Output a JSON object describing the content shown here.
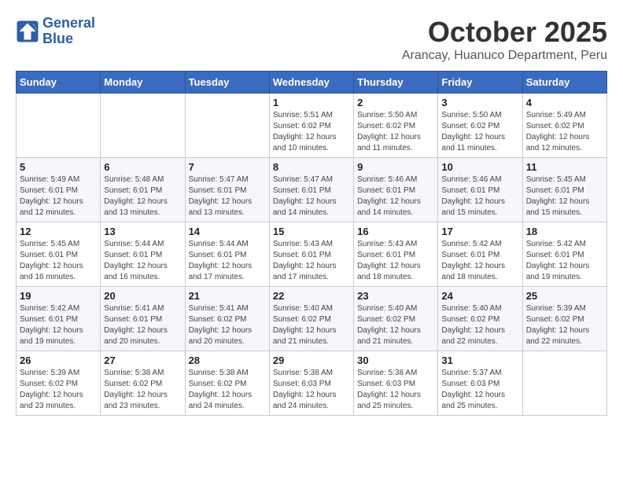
{
  "header": {
    "logo_line1": "General",
    "logo_line2": "Blue",
    "month_title": "October 2025",
    "location": "Arancay, Huanuco Department, Peru"
  },
  "weekdays": [
    "Sunday",
    "Monday",
    "Tuesday",
    "Wednesday",
    "Thursday",
    "Friday",
    "Saturday"
  ],
  "weeks": [
    [
      {
        "day": "",
        "info": ""
      },
      {
        "day": "",
        "info": ""
      },
      {
        "day": "",
        "info": ""
      },
      {
        "day": "1",
        "info": "Sunrise: 5:51 AM\nSunset: 6:02 PM\nDaylight: 12 hours\nand 10 minutes."
      },
      {
        "day": "2",
        "info": "Sunrise: 5:50 AM\nSunset: 6:02 PM\nDaylight: 12 hours\nand 11 minutes."
      },
      {
        "day": "3",
        "info": "Sunrise: 5:50 AM\nSunset: 6:02 PM\nDaylight: 12 hours\nand 11 minutes."
      },
      {
        "day": "4",
        "info": "Sunrise: 5:49 AM\nSunset: 6:02 PM\nDaylight: 12 hours\nand 12 minutes."
      }
    ],
    [
      {
        "day": "5",
        "info": "Sunrise: 5:49 AM\nSunset: 6:01 PM\nDaylight: 12 hours\nand 12 minutes."
      },
      {
        "day": "6",
        "info": "Sunrise: 5:48 AM\nSunset: 6:01 PM\nDaylight: 12 hours\nand 13 minutes."
      },
      {
        "day": "7",
        "info": "Sunrise: 5:47 AM\nSunset: 6:01 PM\nDaylight: 12 hours\nand 13 minutes."
      },
      {
        "day": "8",
        "info": "Sunrise: 5:47 AM\nSunset: 6:01 PM\nDaylight: 12 hours\nand 14 minutes."
      },
      {
        "day": "9",
        "info": "Sunrise: 5:46 AM\nSunset: 6:01 PM\nDaylight: 12 hours\nand 14 minutes."
      },
      {
        "day": "10",
        "info": "Sunrise: 5:46 AM\nSunset: 6:01 PM\nDaylight: 12 hours\nand 15 minutes."
      },
      {
        "day": "11",
        "info": "Sunrise: 5:45 AM\nSunset: 6:01 PM\nDaylight: 12 hours\nand 15 minutes."
      }
    ],
    [
      {
        "day": "12",
        "info": "Sunrise: 5:45 AM\nSunset: 6:01 PM\nDaylight: 12 hours\nand 16 minutes."
      },
      {
        "day": "13",
        "info": "Sunrise: 5:44 AM\nSunset: 6:01 PM\nDaylight: 12 hours\nand 16 minutes."
      },
      {
        "day": "14",
        "info": "Sunrise: 5:44 AM\nSunset: 6:01 PM\nDaylight: 12 hours\nand 17 minutes."
      },
      {
        "day": "15",
        "info": "Sunrise: 5:43 AM\nSunset: 6:01 PM\nDaylight: 12 hours\nand 17 minutes."
      },
      {
        "day": "16",
        "info": "Sunrise: 5:43 AM\nSunset: 6:01 PM\nDaylight: 12 hours\nand 18 minutes."
      },
      {
        "day": "17",
        "info": "Sunrise: 5:42 AM\nSunset: 6:01 PM\nDaylight: 12 hours\nand 18 minutes."
      },
      {
        "day": "18",
        "info": "Sunrise: 5:42 AM\nSunset: 6:01 PM\nDaylight: 12 hours\nand 19 minutes."
      }
    ],
    [
      {
        "day": "19",
        "info": "Sunrise: 5:42 AM\nSunset: 6:01 PM\nDaylight: 12 hours\nand 19 minutes."
      },
      {
        "day": "20",
        "info": "Sunrise: 5:41 AM\nSunset: 6:01 PM\nDaylight: 12 hours\nand 20 minutes."
      },
      {
        "day": "21",
        "info": "Sunrise: 5:41 AM\nSunset: 6:02 PM\nDaylight: 12 hours\nand 20 minutes."
      },
      {
        "day": "22",
        "info": "Sunrise: 5:40 AM\nSunset: 6:02 PM\nDaylight: 12 hours\nand 21 minutes."
      },
      {
        "day": "23",
        "info": "Sunrise: 5:40 AM\nSunset: 6:02 PM\nDaylight: 12 hours\nand 21 minutes."
      },
      {
        "day": "24",
        "info": "Sunrise: 5:40 AM\nSunset: 6:02 PM\nDaylight: 12 hours\nand 22 minutes."
      },
      {
        "day": "25",
        "info": "Sunrise: 5:39 AM\nSunset: 6:02 PM\nDaylight: 12 hours\nand 22 minutes."
      }
    ],
    [
      {
        "day": "26",
        "info": "Sunrise: 5:39 AM\nSunset: 6:02 PM\nDaylight: 12 hours\nand 23 minutes."
      },
      {
        "day": "27",
        "info": "Sunrise: 5:38 AM\nSunset: 6:02 PM\nDaylight: 12 hours\nand 23 minutes."
      },
      {
        "day": "28",
        "info": "Sunrise: 5:38 AM\nSunset: 6:02 PM\nDaylight: 12 hours\nand 24 minutes."
      },
      {
        "day": "29",
        "info": "Sunrise: 5:38 AM\nSunset: 6:03 PM\nDaylight: 12 hours\nand 24 minutes."
      },
      {
        "day": "30",
        "info": "Sunrise: 5:38 AM\nSunset: 6:03 PM\nDaylight: 12 hours\nand 25 minutes."
      },
      {
        "day": "31",
        "info": "Sunrise: 5:37 AM\nSunset: 6:03 PM\nDaylight: 12 hours\nand 25 minutes."
      },
      {
        "day": "",
        "info": ""
      }
    ]
  ]
}
